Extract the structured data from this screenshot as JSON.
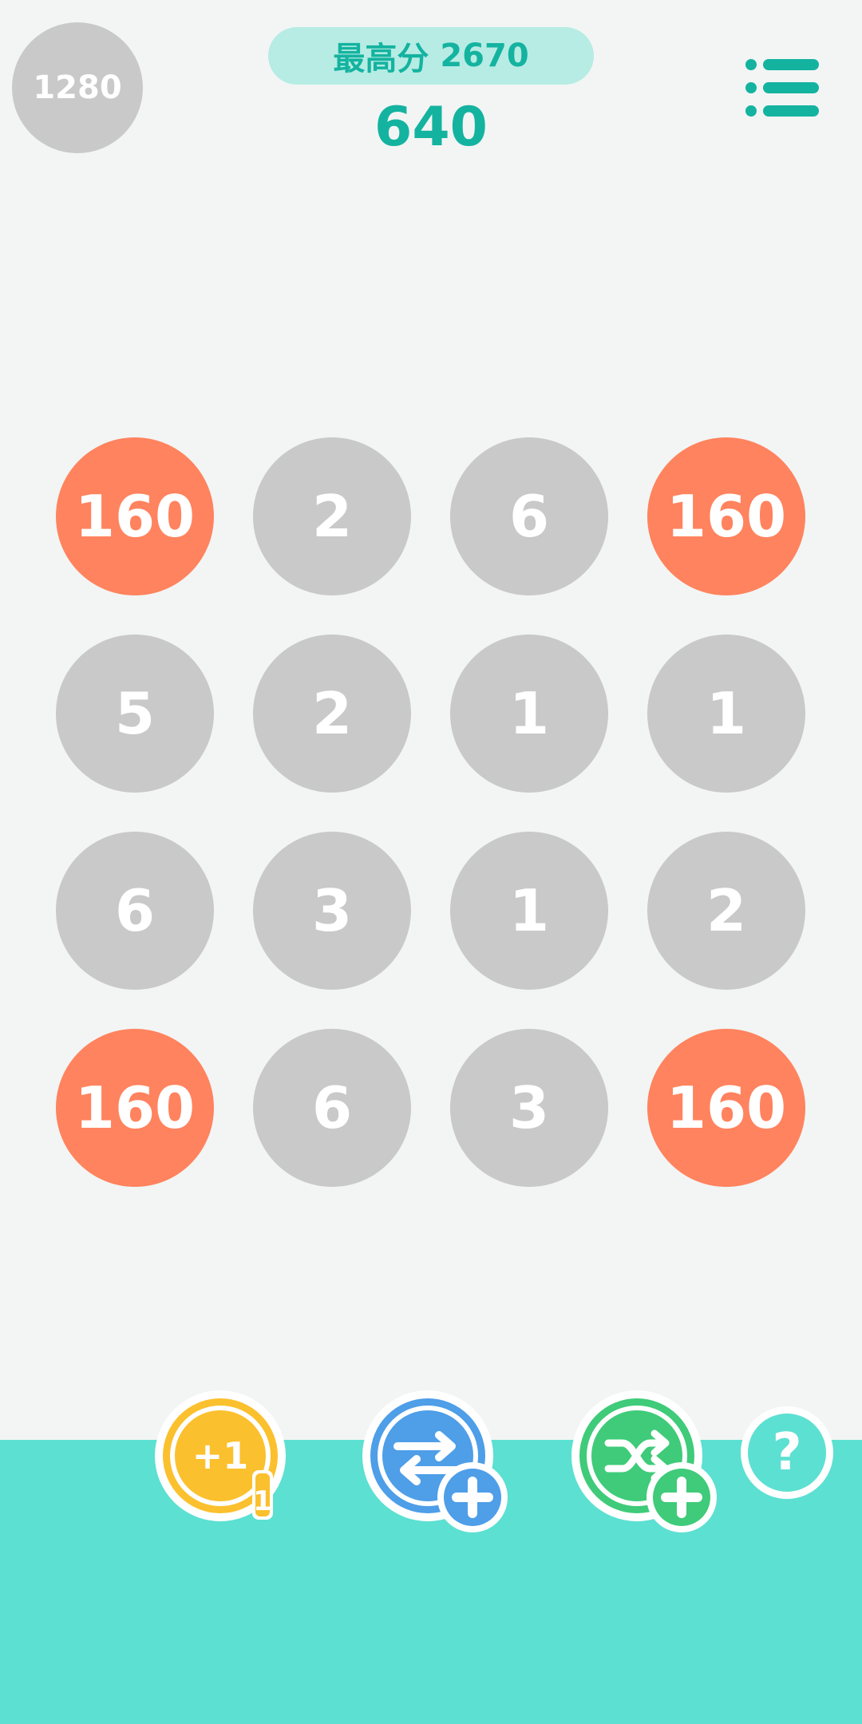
{
  "header": {
    "goal": "1280",
    "best_label": "最高分",
    "best_value": "2670",
    "current_score": "640"
  },
  "board": {
    "rows": [
      [
        "160",
        "2",
        "6",
        "160"
      ],
      [
        "5",
        "2",
        "1",
        "1"
      ],
      [
        "6",
        "3",
        "1",
        "2"
      ],
      [
        "160",
        "6",
        "3",
        "160"
      ]
    ],
    "highlight_value": "160"
  },
  "tools": {
    "plus_one_label": "+1",
    "plus_one_count": "1",
    "help_label": "?"
  },
  "icons": {
    "menu": "list-menu-icon",
    "plus_one": "plus-one-icon",
    "swap": "swap-arrows-icon",
    "shuffle": "shuffle-icon",
    "add": "plus-icon",
    "help": "question-mark-icon"
  },
  "colors": {
    "accent": "#14b3a0",
    "pill": "#b6ece4",
    "tile_gray": "#c8c9c8",
    "tile_orange": "#ff835e",
    "bottom_band": "#5ce0d2",
    "yellow": "#fbc02d",
    "blue": "#4e9ee8",
    "green": "#3fcb79"
  }
}
